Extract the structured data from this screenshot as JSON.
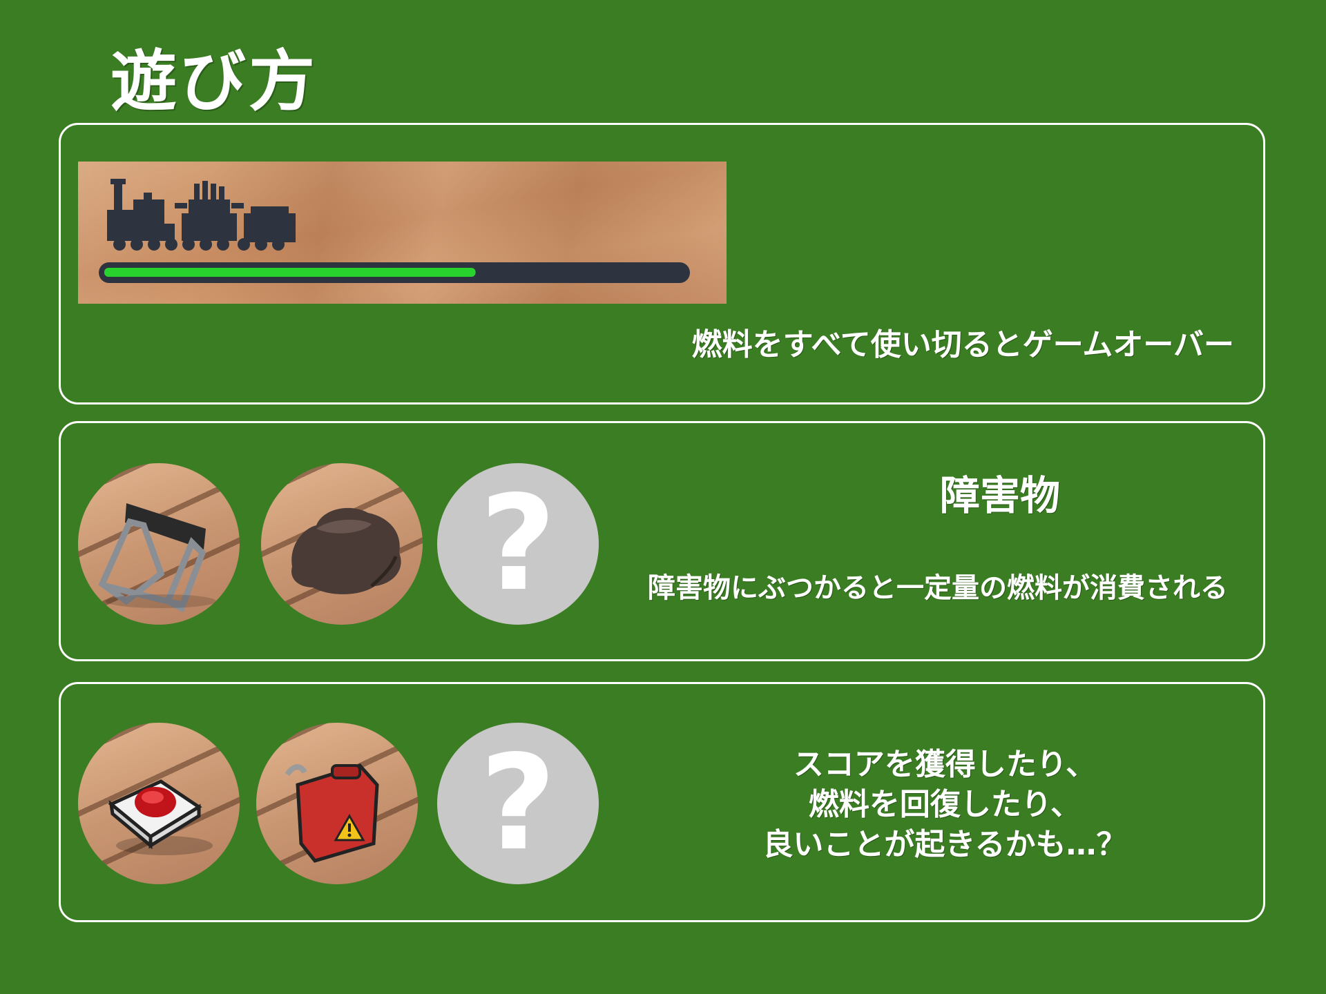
{
  "title": "遊び方",
  "fuel_section": {
    "caption": "燃料をすべて使い切るとゲームオーバー",
    "fuel_level": 0.64,
    "bar_fill_color": "#29d32e",
    "bar_track_color": "#2e3340",
    "train_color": "#2e3340"
  },
  "obstacle_section": {
    "heading": "障害物",
    "caption": "障害物にぶつかると一定量の燃料が消費される",
    "icons": [
      "hurdle-barrier-icon",
      "rock-icon",
      "mystery-icon"
    ],
    "mystery_symbol": "?"
  },
  "item_section": {
    "caption_lines": [
      "スコアを獲得したり、",
      "燃料を回復したり、",
      "良いことが起きるかも…？"
    ],
    "icons": [
      "red-button-icon",
      "fuel-can-icon",
      "mystery-icon"
    ],
    "mystery_symbol": "?"
  }
}
